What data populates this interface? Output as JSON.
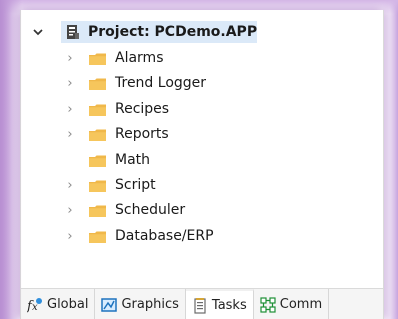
{
  "project": {
    "root_label": "Project: PCDemo.APP",
    "expanded_icon": "chevron-down-icon",
    "root_icon": "project-icon"
  },
  "tree": {
    "items": [
      {
        "label": "Alarms",
        "expandable": true
      },
      {
        "label": "Trend Logger",
        "expandable": true
      },
      {
        "label": "Recipes",
        "expandable": true
      },
      {
        "label": "Reports",
        "expandable": true
      },
      {
        "label": "Math",
        "expandable": false
      },
      {
        "label": "Script",
        "expandable": true
      },
      {
        "label": "Scheduler",
        "expandable": true
      },
      {
        "label": "Database/ERP",
        "expandable": true
      }
    ]
  },
  "tabs": [
    {
      "label": "Global",
      "icon": "function-icon",
      "active": false
    },
    {
      "label": "Graphics",
      "icon": "graphics-icon",
      "active": false
    },
    {
      "label": "Tasks",
      "icon": "tasks-icon",
      "active": true
    },
    {
      "label": "Comm",
      "icon": "communication-icon",
      "active": false
    }
  ],
  "colors": {
    "selection": "#dbe9f8",
    "folder": "#f0b84a",
    "tab_background": "#f5f5f5",
    "active_tab": "#ffffff"
  }
}
